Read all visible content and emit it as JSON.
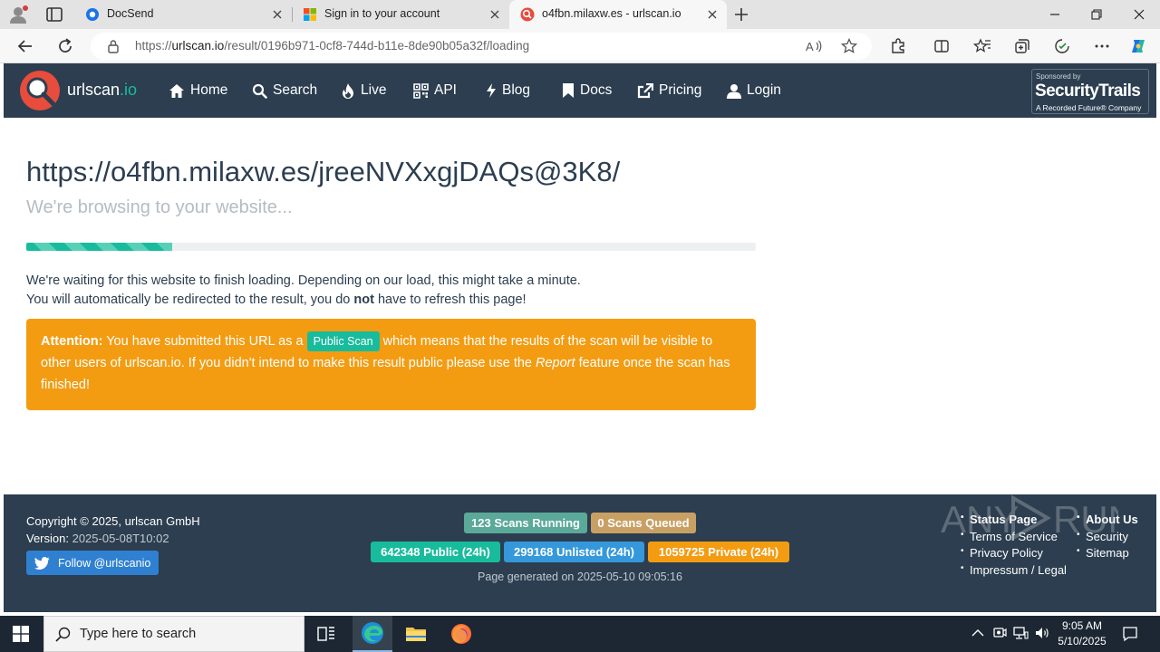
{
  "browser": {
    "tabs": [
      {
        "title": "DocSend"
      },
      {
        "title": "Sign in to your account"
      },
      {
        "title": "o4fbn.milaxw.es - urlscan.io"
      }
    ],
    "address": {
      "prefix": "https://",
      "domain": "urlscan.io",
      "path": "/result/0196b971-0cf8-744d-b11e-8de90b05a32f/loading"
    }
  },
  "site": {
    "logo_main": "urlscan",
    "logo_suffix": ".io",
    "nav": [
      "Home",
      "Search",
      "Live",
      "API",
      "Blog",
      "Docs",
      "Pricing",
      "Login"
    ],
    "sponsor": {
      "line1": "Sponsored by",
      "line2": "SecurityTrails",
      "line3": "A Recorded Future® Company"
    }
  },
  "main": {
    "title": "https://o4fbn.milaxw.es/jreeNVXxgjDAQs@3K8/",
    "subtitle": "We're browsing to your website...",
    "progress": 0.2,
    "info_line1": "We're waiting for this website to finish loading. Depending on our load, this might take a minute.",
    "info_line2_a": "You will automatically be redirected to the result, you do ",
    "info_line2_b": "not",
    "info_line2_c": " have to refresh this page!",
    "alert": {
      "label": "Attention:",
      "t1": " You have submitted this URL as a ",
      "pill": "Public Scan",
      "t2": " which means that the results of the scan will be visible to other users of urlscan.io. If you didn't intend to make this result public please use the ",
      "t3": "Report",
      "t4": " feature once the scan has finished!"
    }
  },
  "footer": {
    "copyright": "Copyright © 2025, urlscan GmbH",
    "version_label": "Version: ",
    "version": "2025-05-08T10:02",
    "twitter": "Follow @urlscanio",
    "badges": {
      "running": "123 Scans Running",
      "queued": "0 Scans Queued",
      "public": "642348 Public (24h)",
      "unlisted": "299168 Unlisted (24h)",
      "private": "1059725 Private (24h)"
    },
    "generated": "Page generated on 2025-05-10 09:05:16",
    "links_col1": [
      "Status Page",
      "Terms of Service",
      "Privacy Policy",
      "Impressum / Legal"
    ],
    "links_col2": [
      "About Us",
      "Security",
      "Sitemap"
    ],
    "colors": {
      "teal": "#18bc9c",
      "orange": "#f39c12",
      "blue": "#3498db",
      "tan": "#c9a064",
      "tealgray": "#5aa999"
    }
  },
  "watermark": "ANY RUN",
  "taskbar": {
    "search_placeholder": "Type here to search",
    "time": "9:05 AM",
    "date": "5/10/2025"
  }
}
